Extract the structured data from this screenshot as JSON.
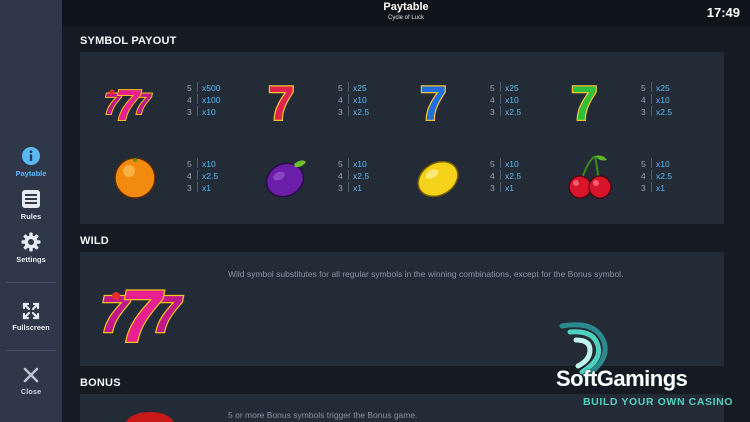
{
  "header": {
    "title": "Paytable",
    "subtitle": "Cycle of Luck",
    "clock": "17:49"
  },
  "nav": {
    "paytable": "Paytable",
    "rules": "Rules",
    "settings": "Settings",
    "fullscreen": "Fullscreen",
    "close": "Close"
  },
  "sections": {
    "symbol_payout": "SYMBOL PAYOUT",
    "wild": "WILD",
    "bonus": "BONUS"
  },
  "symbols": [
    {
      "name": "triple-seven",
      "pays": [
        {
          "n": "5",
          "m": "x500"
        },
        {
          "n": "4",
          "m": "x100"
        },
        {
          "n": "3",
          "m": "x10"
        }
      ]
    },
    {
      "name": "red-seven",
      "pays": [
        {
          "n": "5",
          "m": "x25"
        },
        {
          "n": "4",
          "m": "x10"
        },
        {
          "n": "3",
          "m": "x2.5"
        }
      ]
    },
    {
      "name": "blue-seven",
      "pays": [
        {
          "n": "5",
          "m": "x25"
        },
        {
          "n": "4",
          "m": "x10"
        },
        {
          "n": "3",
          "m": "x2.5"
        }
      ]
    },
    {
      "name": "green-seven",
      "pays": [
        {
          "n": "5",
          "m": "x25"
        },
        {
          "n": "4",
          "m": "x10"
        },
        {
          "n": "3",
          "m": "x2.5"
        }
      ]
    },
    {
      "name": "orange",
      "pays": [
        {
          "n": "5",
          "m": "x10"
        },
        {
          "n": "4",
          "m": "x2.5"
        },
        {
          "n": "3",
          "m": "x1"
        }
      ]
    },
    {
      "name": "plum",
      "pays": [
        {
          "n": "5",
          "m": "x10"
        },
        {
          "n": "4",
          "m": "x2.5"
        },
        {
          "n": "3",
          "m": "x1"
        }
      ]
    },
    {
      "name": "lemon",
      "pays": [
        {
          "n": "5",
          "m": "x10"
        },
        {
          "n": "4",
          "m": "x2.5"
        },
        {
          "n": "3",
          "m": "x1"
        }
      ]
    },
    {
      "name": "cherries",
      "pays": [
        {
          "n": "5",
          "m": "x10"
        },
        {
          "n": "4",
          "m": "x2.5"
        },
        {
          "n": "3",
          "m": "x1"
        }
      ]
    }
  ],
  "wild": {
    "description": "Wild symbol substitutes for all regular symbols in the winning combinations, except for the Bonus symbol."
  },
  "bonus": {
    "description": "5 or more Bonus symbols trigger the Bonus game."
  },
  "watermark": {
    "brand": "SoftGamings",
    "tagline": "BUILD YOUR OWN CASINO"
  },
  "colors": {
    "accent": "#5ab8f5",
    "panel": "#232b37",
    "sidebar": "#2f3848",
    "brand_teal": "#4fd1c0"
  }
}
